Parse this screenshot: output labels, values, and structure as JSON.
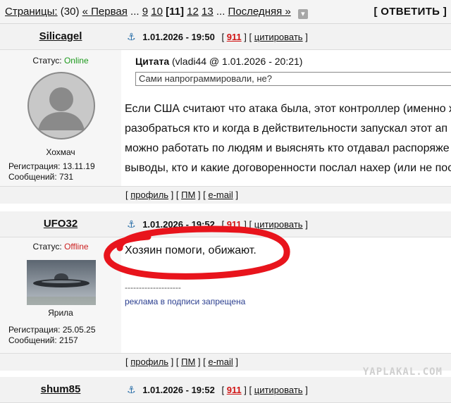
{
  "pager": {
    "label": "Страницы:",
    "total": "(30)",
    "first": "« Первая",
    "ellipsis": "...",
    "p9": "9",
    "p10": "10",
    "current": "[11]",
    "p12": "12",
    "p13": "13",
    "last": "Последняя »",
    "reply": "[ ОТВЕТИТЬ ]"
  },
  "posts": [
    {
      "nick": "Silicagel",
      "date": "1.01.2026 - 19:50",
      "rating": "911",
      "quote_link": "цитировать",
      "status_label": "Статус:",
      "status": "Online",
      "username_caption": "Хохмач",
      "reg": "Регистрация: 13.11.19",
      "msgs": "Сообщений: 731",
      "quote_title": "Цитата",
      "quote_src": "(vladi44 @ 1.01.2026 - 20:21)",
      "quote_text": "Сами напрограммировали, не?",
      "lines": [
        "Если США считают что атака была, этот контроллер (именно ж",
        "разобраться кто и когда в действительности запускал этот ап",
        "можно работать по людям и выяснять кто отдавал распоряже",
        "выводы, кто и какие договоренности послал нахер (или не пос"
      ],
      "profile": "профиль",
      "pm": "ПМ",
      "email": "e-mail"
    },
    {
      "nick": "UFO32",
      "date": "1.01.2026 - 19:52",
      "rating": "911",
      "quote_link": "цитировать",
      "status_label": "Статус:",
      "status": "Offline",
      "username_caption": "Ярила",
      "reg": "Регистрация: 25.05.25",
      "msgs": "Сообщений: 2157",
      "text": "Хозяин помоги, обижают.",
      "sig_line": "--------------------",
      "signature": "реклама в подписи запрещена",
      "profile": "профиль",
      "pm": "ПМ",
      "email": "e-mail"
    },
    {
      "nick": "shum85",
      "date": "1.01.2026 - 19:52",
      "rating": "911",
      "quote_link": "цитировать"
    }
  ],
  "watermark": "YAPLAKAL.COM",
  "colors": {
    "online": "#1e9a1e",
    "offline": "#cc2222",
    "rating": "#d01515",
    "annotation": "#e8141c"
  }
}
